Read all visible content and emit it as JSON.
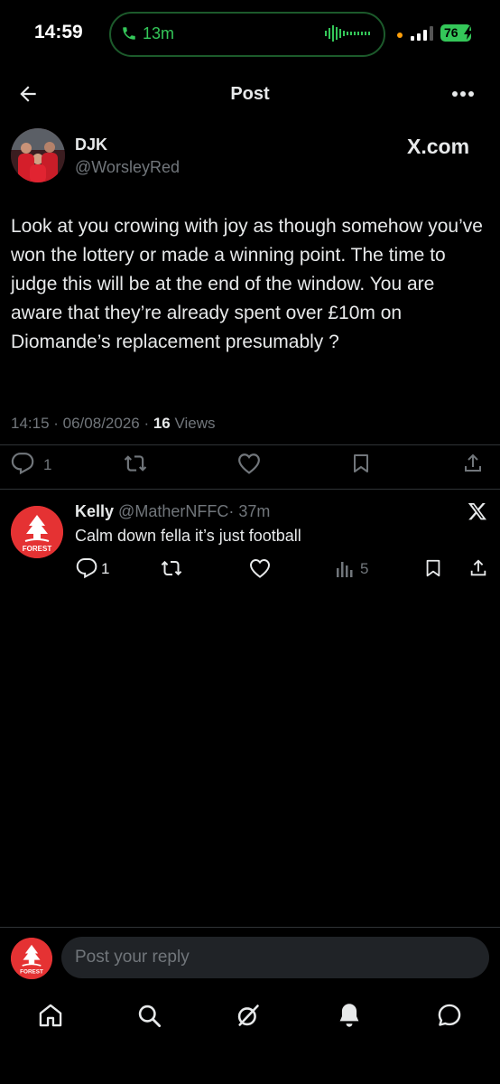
{
  "status_bar": {
    "time": "14:59",
    "call_duration": "13m",
    "battery_level": "76"
  },
  "header": {
    "title": "Post"
  },
  "post": {
    "display_name": "DJK",
    "handle": "@WorsleyRed",
    "source_badge": "X.com",
    "text": "Look at you crowing with joy as though somehow you’ve won the lottery or made a winning point. The time to judge this will be at the end of the window. You are aware that they’re already spent over £10m on Diomande’s replacement presumably ?",
    "timestamp": "14:15 · 06/08/2026 · ",
    "views_count": "16",
    "views_label": " Views",
    "reply_count": "1"
  },
  "reply": {
    "display_name": "Kelly",
    "handle": "@MatherNFFC",
    "age": "· 37m",
    "text": "Calm down fella it’s just football",
    "reply_count": "1",
    "view_count": "5",
    "avatar_label": "FOREST"
  },
  "compose": {
    "placeholder": "Post your reply"
  },
  "colors": {
    "background": "#000000",
    "text": "#e7e9ea",
    "secondary": "#71767b",
    "call_green": "#34c759",
    "forest_red": "#e53233"
  }
}
